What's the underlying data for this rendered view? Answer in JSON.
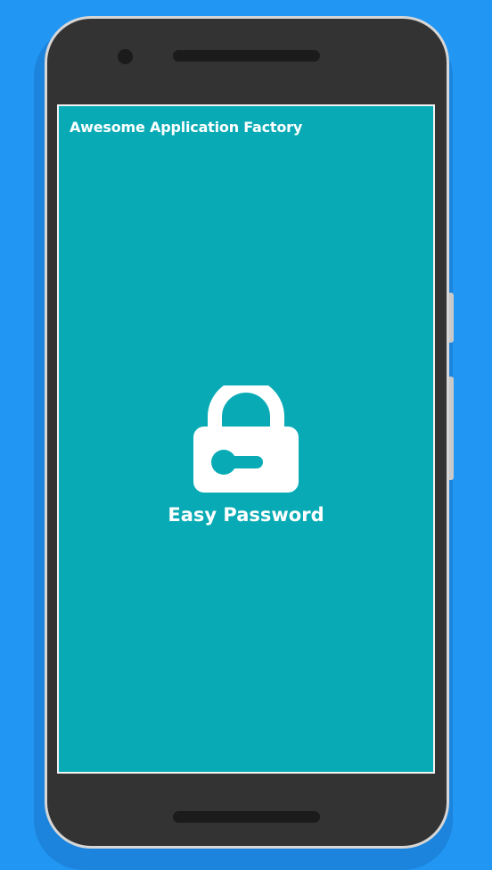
{
  "screen": {
    "app_title": "Awesome Application Factory",
    "app_name": "Easy Password",
    "background_color": "#08abb5"
  },
  "device": {
    "body_color": "#333333",
    "frame_color": "#d6d6d6"
  },
  "page": {
    "background_color": "#2196f3"
  },
  "icons": {
    "lock": "lock-icon"
  }
}
